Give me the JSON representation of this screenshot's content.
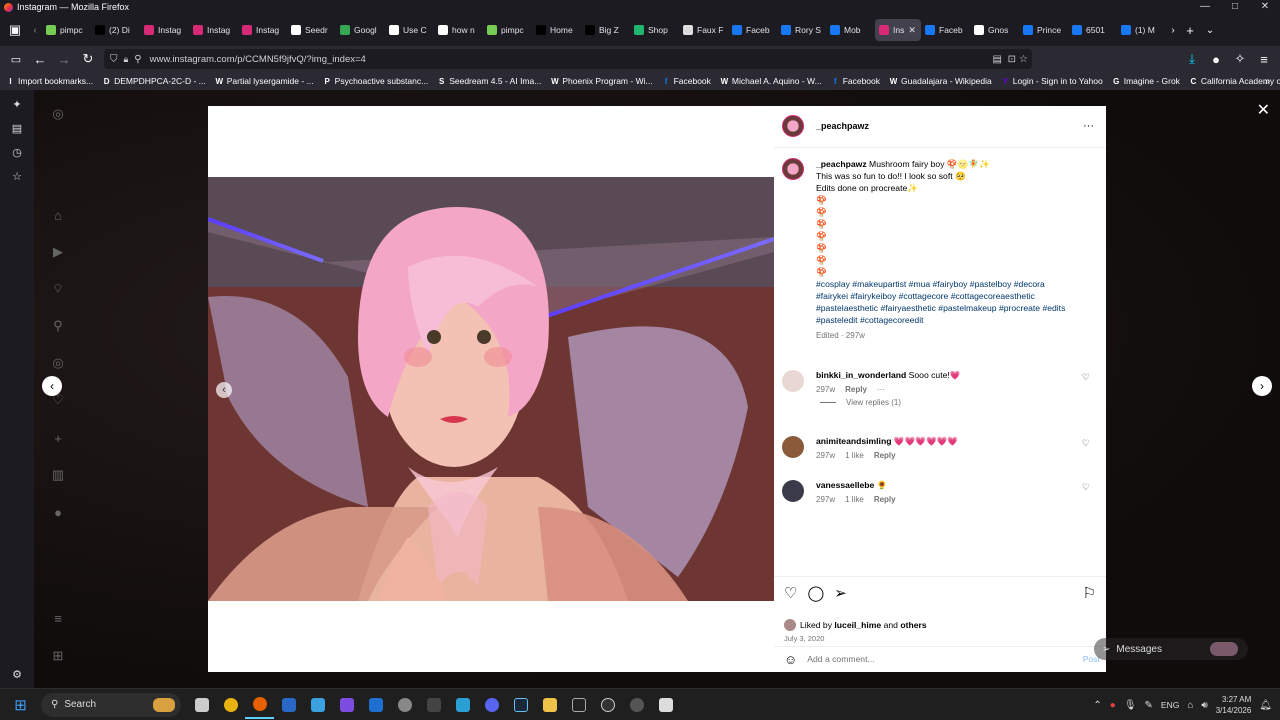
{
  "window": {
    "title": "Instagram — Mozilla Firefox",
    "controls": [
      "—",
      "□",
      "✕"
    ]
  },
  "tabs": [
    {
      "label": "pimpc",
      "color": "#7c5"
    },
    {
      "label": "(2) Di",
      "color": "#000"
    },
    {
      "label": "Instag",
      "color": "#d62976"
    },
    {
      "label": "Instag",
      "color": "#d62976"
    },
    {
      "label": "Instag",
      "color": "#d62976"
    },
    {
      "label": "Seedr",
      "color": "#fff"
    },
    {
      "label": "Googl",
      "color": "#34a853"
    },
    {
      "label": "Use C",
      "color": "#fff"
    },
    {
      "label": "how n",
      "color": "#fff"
    },
    {
      "label": "pimpc",
      "color": "#7c5"
    },
    {
      "label": "Home",
      "color": "#000"
    },
    {
      "label": "Big Z",
      "color": "#000"
    },
    {
      "label": "Shop",
      "color": "#21b66f"
    },
    {
      "label": "Faux F",
      "color": "#ddd"
    },
    {
      "label": "Faceb",
      "color": "#1877f2"
    },
    {
      "label": "Rory S",
      "color": "#1877f2"
    },
    {
      "label": "Mob",
      "color": "#1877f2"
    },
    {
      "label": "Ins",
      "color": "#d62976",
      "active": true
    },
    {
      "label": "Faceb",
      "color": "#1877f2"
    },
    {
      "label": "Gnos",
      "color": "#fff"
    },
    {
      "label": "Prince",
      "color": "#1877f2"
    },
    {
      "label": "6501",
      "color": "#1877f2"
    },
    {
      "label": "(1) M",
      "color": "#1877f2"
    }
  ],
  "url": "www.instagram.com/p/CCMN5f9jfvQ/?img_index=4",
  "bookmarks": [
    {
      "label": "Import bookmarks...",
      "icon": "I",
      "color": "#fbfbfe"
    },
    {
      "label": "DEMPDHPCA-2C-D - ...",
      "icon": "D",
      "color": "#ffffff"
    },
    {
      "label": "Partial lysergamide - ...",
      "icon": "W",
      "color": "#ffffff"
    },
    {
      "label": "Psychoactive substanc...",
      "icon": "P",
      "color": "#ffffff"
    },
    {
      "label": "Seedream 4.5 - AI Ima...",
      "icon": "S",
      "color": "#ffffff"
    },
    {
      "label": "Phoenix Program - Wi...",
      "icon": "W",
      "color": "#ffffff"
    },
    {
      "label": "Facebook",
      "icon": "f",
      "color": "#1877f2"
    },
    {
      "label": "Michael A. Aquino - W...",
      "icon": "W",
      "color": "#ffffff"
    },
    {
      "label": "Facebook",
      "icon": "f",
      "color": "#1877f2"
    },
    {
      "label": "Guadalajara - Wikipedia",
      "icon": "W",
      "color": "#ffffff"
    },
    {
      "label": "Login - Sign in to Yahoo",
      "icon": "Y",
      "color": "#6001d2"
    },
    {
      "label": "Imagine - Grok",
      "icon": "G",
      "color": "#ffffff"
    },
    {
      "label": "California Academy of...",
      "icon": "C",
      "color": "#ffffff"
    }
  ],
  "post": {
    "username": "_peachpawz",
    "caption_lines": [
      "Mushroom fairy boy 🍄🌝🧚✨",
      "This was so fun to do!! I look so soft 🥺",
      "Edits done on procreate✨"
    ],
    "mushrooms": [
      "🍄",
      "🍄",
      "🍄",
      "🍄",
      "🍄",
      "🍄",
      "🍄"
    ],
    "hashtags": "#cosplay #makeupartist #mua #fairyboy #pastelboy #decora #fairykei #fairykeiboy #cottagecore #cottagecoreaesthetic #pastelaesthetic #fairyaesthetic #pastelmakeup #procreate #edits #pasteledit #cottagecoreedit",
    "edited": "Edited · 297w",
    "comments": [
      {
        "user": "binkki_in_wonderland",
        "text": "Sooo cute!💗",
        "time": "297w",
        "likes": "",
        "reply": "Reply",
        "more": "···",
        "color": "#e9d7d3"
      },
      {
        "user": "animiteandsimling",
        "text": "💗💗💗💗💗💗",
        "time": "297w",
        "likes": "1 like",
        "reply": "Reply",
        "color": "#8a5a3a"
      },
      {
        "user": "vanessaellebe",
        "text": "🌻",
        "time": "297w",
        "likes": "1 like",
        "reply": "Reply",
        "color": "#3a3a4a"
      }
    ],
    "view_replies": "View replies (1)",
    "liked_by_prefix": "Liked by",
    "liked_by_user": "luceil_hime",
    "liked_by_and": "and",
    "liked_by_others": "others",
    "date": "July 3, 2020",
    "add_comment_placeholder": "Add a comment...",
    "post_button": "Post"
  },
  "messages": "Messages",
  "taskbar": {
    "search": "Search",
    "time": "3:27 AM",
    "date": "3/14/2026",
    "lang": "ENG"
  }
}
